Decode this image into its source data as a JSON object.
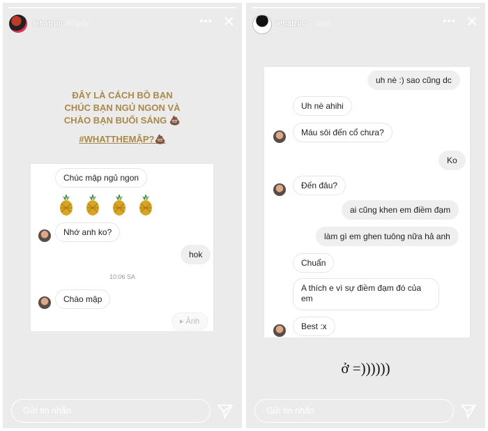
{
  "left_story": {
    "username": "lehatruc",
    "time": "47giây",
    "caption_lines": [
      "ĐÂY LÀ CÁCH BỒ BẠN",
      "CHÚC BẠN NGỦ NGON VÀ",
      "CHÀO BẠN BUỔI SÁNG 💩"
    ],
    "hashtag": "#WHATTHEMẬP?💩",
    "messages": {
      "m1": "Chúc mập ngủ ngon",
      "m2": "Nhớ anh ko?",
      "m3": "hok",
      "timestamp": "10:06 SA",
      "m4": "Chào mập",
      "photo_button": "Ảnh"
    },
    "reply_placeholder": "Gửi tin nhắn"
  },
  "right_story": {
    "username": "lehatruc",
    "time": "1giờ",
    "messages": {
      "r1": "uh nè :) sao cũng dc",
      "r2": "Uh nè ahihi",
      "r3": "Máu sôi đến cổ chưa?",
      "r4": "Ko",
      "r5": "Đến đâu?",
      "r6": "ai cũng khen em điềm đạm",
      "r7": "làm gì em ghen tuông nữa hả anh",
      "r8": "Chuẩn",
      "r9": "A thích e vì sự điềm đạm đó của em",
      "r10": "Best :x"
    },
    "reaction_text": "ở =))))))",
    "reply_placeholder": "Gửi tin nhắn"
  },
  "icons": {
    "more": "more-horizontal-icon",
    "close": "close-icon",
    "send": "send-icon",
    "photo": "camera-icon"
  }
}
